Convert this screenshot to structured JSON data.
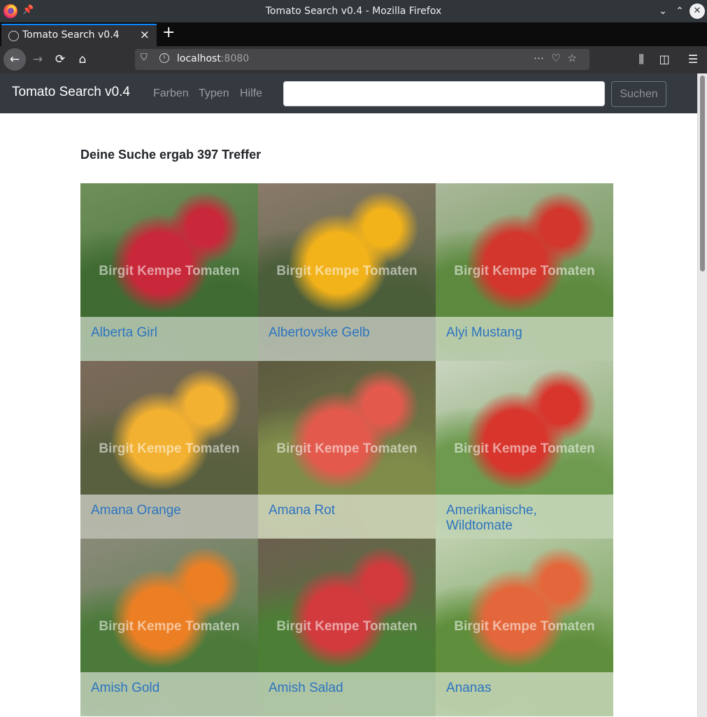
{
  "window": {
    "title": "Tomato Search v0.4 - Mozilla Firefox"
  },
  "browser": {
    "tab": {
      "label": "Tomato Search v0.4"
    },
    "url": {
      "host": "localhost",
      "port": ":8080"
    }
  },
  "app": {
    "brand": "Tomato Search v0.4",
    "nav": [
      "Farben",
      "Typen",
      "Hilfe"
    ],
    "search": {
      "value": "",
      "button": "Suchen"
    },
    "heading": "Deine Suche ergab 397 Treffer",
    "watermark": "Birgit Kempe Tomaten",
    "results": [
      {
        "name": "Alberta Girl",
        "colors": [
          "#c8283a",
          "#3f6b32",
          "#6f8f5a"
        ]
      },
      {
        "name": "Albertovske Gelb",
        "colors": [
          "#f2b21a",
          "#4b5e3a",
          "#8a7a6a"
        ]
      },
      {
        "name": "Alyi Mustang",
        "colors": [
          "#d2362c",
          "#5d8a3f",
          "#a9b89a"
        ]
      },
      {
        "name": "Amana Orange",
        "colors": [
          "#f3b131",
          "#59603f",
          "#7b6a5a"
        ]
      },
      {
        "name": "Amana Rot",
        "colors": [
          "#e35a4d",
          "#7f8c4a",
          "#5c5a40"
        ]
      },
      {
        "name": "Amerikanische, Wildtomate",
        "colors": [
          "#d8352c",
          "#6e9a4f",
          "#c9d4c0"
        ]
      },
      {
        "name": "Amish Gold",
        "colors": [
          "#ec7f24",
          "#4c7a3a",
          "#8a8a7a"
        ]
      },
      {
        "name": "Amish Salad",
        "colors": [
          "#d33a3e",
          "#4c7f35",
          "#6b5f4e"
        ]
      },
      {
        "name": "Ananas",
        "colors": [
          "#e4673b",
          "#5f8f3c",
          "#bfd0b0"
        ]
      }
    ]
  }
}
